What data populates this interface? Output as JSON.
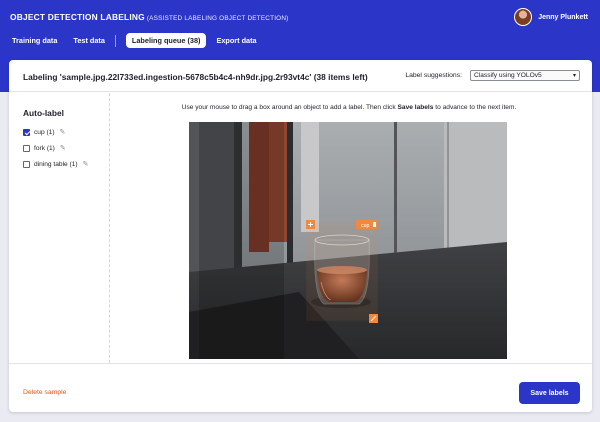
{
  "header": {
    "title": "OBJECT DETECTION LABELING",
    "subtitle": "(ASSISTED LABELING OBJECT DETECTION)",
    "user_name": "Jenny Plunkett"
  },
  "tabs": [
    {
      "label": "Training data",
      "active": false
    },
    {
      "label": "Test data",
      "active": false
    },
    {
      "label": "Labeling queue (38)",
      "active": true
    },
    {
      "label": "Export data",
      "active": false
    }
  ],
  "labeling": {
    "title": "Labeling 'sample.jpg.22l733ed.ingestion-5678c5b4c4-nh9dr.jpg.2r93vt4c' (38 items left)",
    "suggestions_label": "Label suggestions:",
    "suggestions_value": "Classify using YOLOv5"
  },
  "autolabel": {
    "title": "Auto-label",
    "items": [
      {
        "label": "cup (1)",
        "checked": true
      },
      {
        "label": "fork (1)",
        "checked": false
      },
      {
        "label": "dining table (1)",
        "checked": false
      }
    ]
  },
  "instructions": {
    "before": "Use your mouse to drag a box around an object to add a label. Then click",
    "bold": "Save labels",
    "after": "to advance to the next item."
  },
  "bounding_box": {
    "tag": "cup"
  },
  "footer": {
    "delete_label": "Delete sample",
    "save_label": "Save labels"
  },
  "colors": {
    "accent": "#2b36c9",
    "box": "#f0883e",
    "delete": "#e05a1b"
  }
}
